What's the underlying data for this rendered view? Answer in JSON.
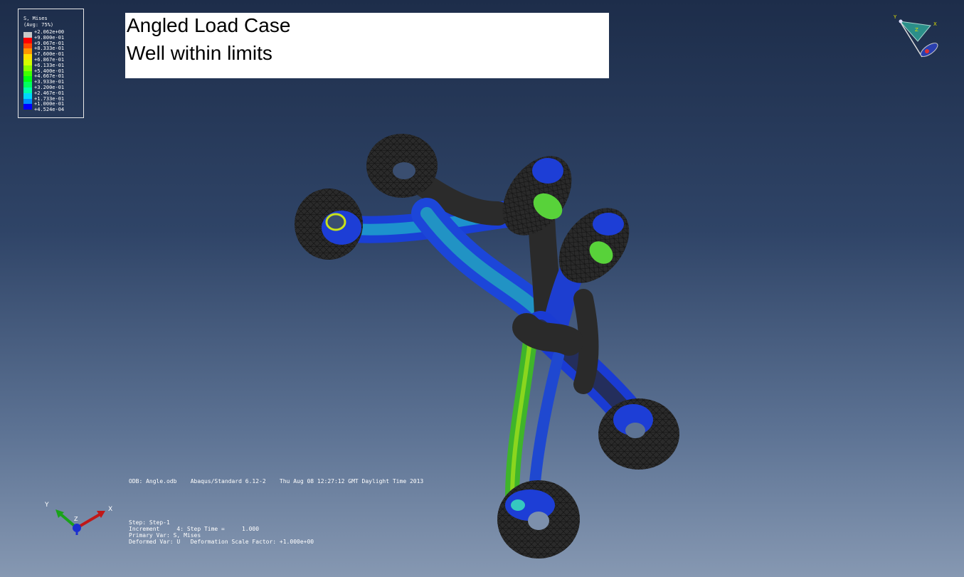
{
  "legend": {
    "title": "S, Mises",
    "subtitle": "(Avg: 75%)",
    "entries": [
      {
        "label": "+2.062e+00",
        "color": "#c8c8c8"
      },
      {
        "label": "+9.800e-01",
        "color": "#ff0000"
      },
      {
        "label": "+9.067e-01",
        "color": "#ff4a00"
      },
      {
        "label": "+8.333e-01",
        "color": "#ff9500"
      },
      {
        "label": "+7.600e-01",
        "color": "#ffdf00"
      },
      {
        "label": "+6.867e-01",
        "color": "#d4ff00"
      },
      {
        "label": "+6.133e-01",
        "color": "#8aff00"
      },
      {
        "label": "+5.400e-01",
        "color": "#40ff00"
      },
      {
        "label": "+4.667e-01",
        "color": "#00ff15"
      },
      {
        "label": "+3.933e-01",
        "color": "#00ff5f"
      },
      {
        "label": "+3.200e-01",
        "color": "#00ffaa"
      },
      {
        "label": "+2.467e-01",
        "color": "#00d8ff"
      },
      {
        "label": "+1.733e-01",
        "color": "#008eff"
      },
      {
        "label": "+1.000e-01",
        "color": "#0000ff"
      },
      {
        "label": "+4.524e-04",
        "color": "#2a2a2a"
      }
    ]
  },
  "note": {
    "line1": "Angled Load Case",
    "line2": "Well within limits"
  },
  "odb_line": "ODB: Angle.odb    Abaqus/Standard 6.12-2    Thu Aug 08 12:27:12 GMT Daylight Time 2013",
  "step_info": {
    "step": "Step: Step-1",
    "increment": "Increment     4: Step Time =     1.000",
    "primary_var": "Primary Var: S, Mises",
    "deformed_var": "Deformed Var: U   Deformation Scale Factor: +1.000e+00"
  },
  "triad": {
    "x": "X",
    "y": "Y",
    "z": "Z"
  },
  "compass": {
    "x": "X",
    "y": "Y",
    "z": "Z"
  }
}
